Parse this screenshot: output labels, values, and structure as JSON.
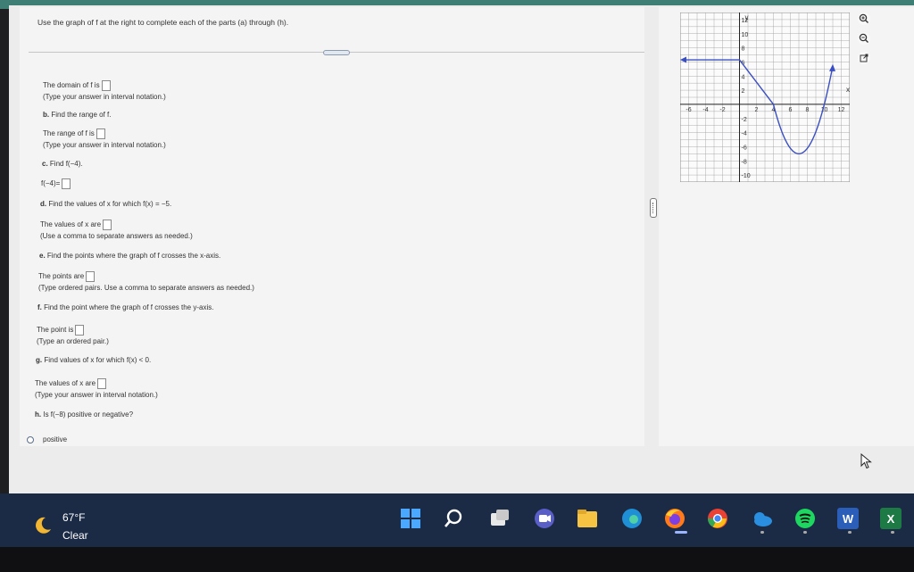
{
  "instruction": "Use the graph of f at the right to complete each of the parts (a) through (h).",
  "questions": {
    "domain_line": "The domain of f is",
    "domain_hint": "(Type your answer in interval notation.)",
    "b_label": "b.",
    "b_text": "Find the range of f.",
    "range_line": "The range of f is",
    "range_hint": "(Type your answer in interval notation.)",
    "c_label": "c.",
    "c_text": "Find f(−4).",
    "c_answer_line": "f(−4)=",
    "d_label": "d.",
    "d_text": "Find the values of x for which f(x) = −5.",
    "d_answer_line": "The values of x are",
    "d_hint": "(Use a comma to separate answers as needed.)",
    "e_label": "e.",
    "e_text": "Find the points where the graph of f crosses the x-axis.",
    "e_answer_line": "The points are",
    "e_hint": "(Type ordered pairs. Use a comma to separate answers as needed.)",
    "f_label": "f.",
    "f_text": "Find the point where the graph of f crosses the y-axis.",
    "f_answer_line": "The point is",
    "f_hint": "(Type an ordered pair.)",
    "g_label": "g.",
    "g_text": "Find values of x for which f(x) < 0.",
    "g_answer_line": "The values of x are",
    "g_hint": "(Type your answer in interval notation.)",
    "h_label": "h.",
    "h_text": "Is f(−8) positive or negative?",
    "option_positive": "positive"
  },
  "graph": {
    "x_axis_label": "x",
    "y_axis_label": "y",
    "x_ticks": [
      "-6",
      "-4",
      "-2",
      "2",
      "4",
      "6",
      "8",
      "10",
      "12"
    ],
    "y_ticks": [
      "12",
      "10",
      "8",
      "6",
      "4",
      "2",
      "-2",
      "-4",
      "-6",
      "-8",
      "-10"
    ],
    "xlim": [
      -7,
      13
    ],
    "ylim": [
      -11,
      13
    ],
    "curve_color": "#3b4fc4",
    "segments": [
      {
        "type": "ray-left",
        "from": [
          -7,
          6.3
        ],
        "to": [
          0,
          6.3
        ]
      },
      {
        "type": "line",
        "points": [
          [
            0,
            6
          ],
          [
            4,
            0
          ]
        ]
      },
      {
        "type": "parabola",
        "vertex": [
          7,
          -7
        ],
        "through": [
          [
            4,
            0
          ],
          [
            10,
            0
          ],
          [
            11,
            12
          ]
        ]
      }
    ]
  },
  "tools": {
    "zoom_in": "zoom-in-icon",
    "zoom_out": "zoom-out-icon",
    "popout": "external-link-icon"
  },
  "taskbar": {
    "temperature": "67°F",
    "condition": "Clear",
    "apps": [
      "windows-start",
      "search",
      "widgets",
      "teams-meet",
      "file-explorer",
      "edge",
      "firefox",
      "chrome",
      "onedrive",
      "spotify",
      "word",
      "excel"
    ]
  },
  "colors": {
    "accent_bar": "#3e7e74",
    "taskbar": "#1b2a45"
  }
}
